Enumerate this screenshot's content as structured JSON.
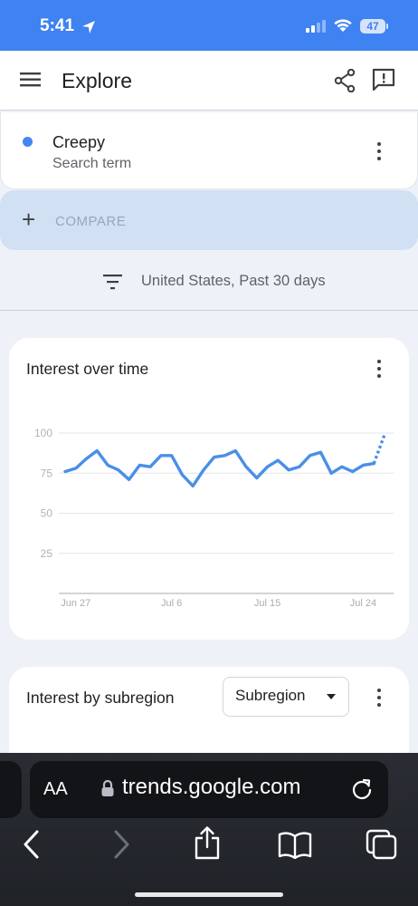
{
  "status_bar": {
    "time": "5:41",
    "battery": "47"
  },
  "app_bar": {
    "title": "Explore"
  },
  "search_term": {
    "name": "Creepy",
    "label": "Search term",
    "color": "#4285f4"
  },
  "compare": {
    "label": "COMPARE"
  },
  "filter": {
    "text": "United States, Past 30 days"
  },
  "interest_over_time": {
    "title": "Interest over time",
    "chart_data": {
      "type": "line",
      "title": "Interest over time",
      "x_tick_labels": [
        "Jun 27",
        "Jul 6",
        "Jul 15",
        "Jul 24"
      ],
      "y_tick_labels": [
        "100",
        "75",
        "50",
        "25"
      ],
      "ylim": [
        0,
        100
      ],
      "grid": true,
      "x": [
        "Jun 26",
        "Jun 27",
        "Jun 28",
        "Jun 29",
        "Jun 30",
        "Jul 1",
        "Jul 2",
        "Jul 3",
        "Jul 4",
        "Jul 5",
        "Jul 6",
        "Jul 7",
        "Jul 8",
        "Jul 9",
        "Jul 10",
        "Jul 11",
        "Jul 12",
        "Jul 13",
        "Jul 14",
        "Jul 15",
        "Jul 16",
        "Jul 17",
        "Jul 18",
        "Jul 19",
        "Jul 20",
        "Jul 21",
        "Jul 22",
        "Jul 23",
        "Jul 24",
        "Jul 25",
        "Jul 26"
      ],
      "values": [
        76,
        78,
        84,
        89,
        80,
        77,
        71,
        80,
        79,
        86,
        86,
        74,
        67,
        77,
        85,
        86,
        89,
        79,
        72,
        79,
        83,
        77,
        79,
        86,
        88,
        75,
        79,
        76,
        80,
        81,
        99
      ],
      "partial_from_index": 29,
      "color": "#4a8fe7"
    }
  },
  "interest_by_subregion": {
    "title": "Interest by subregion",
    "select_value": "Subregion"
  },
  "browser": {
    "aa_label": "AA",
    "url": "trends.google.com"
  }
}
